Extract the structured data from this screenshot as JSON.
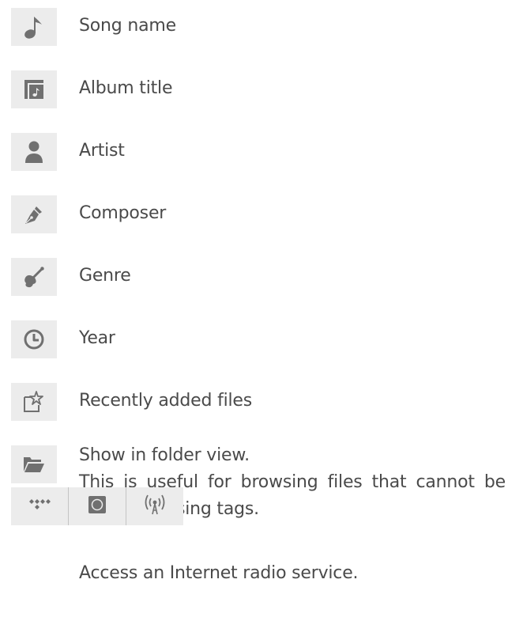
{
  "rows": [
    {
      "icon": "music-note-icon",
      "label": "Song name"
    },
    {
      "icon": "album-icon",
      "label": "Album title"
    },
    {
      "icon": "person-icon",
      "label": "Artist"
    },
    {
      "icon": "pen-nib-icon",
      "label": "Composer"
    },
    {
      "icon": "guitar-icon",
      "label": "Genre"
    },
    {
      "icon": "clock-icon",
      "label": "Year"
    },
    {
      "icon": "new-file-star-icon",
      "label": "Recently added files"
    }
  ],
  "folder": {
    "icon": "folder-open-icon",
    "line1": "Show in folder view.",
    "line2": "This is useful for browsing files that cannot be managed using tags."
  },
  "services": {
    "icons": [
      "tidal-icon",
      "qobuz-icon",
      "internet-radio-icon"
    ],
    "description": "Access an Internet radio service."
  },
  "colors": {
    "icon_fill": "#707070",
    "icon_bg": "#ececec",
    "text": "#4a4a4a"
  }
}
